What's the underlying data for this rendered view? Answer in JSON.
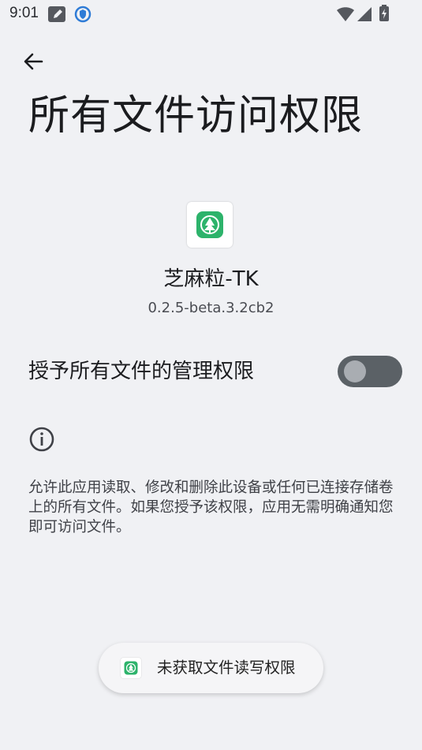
{
  "status_bar": {
    "time": "9:01",
    "icons": [
      "edit-note-icon",
      "shield-icon",
      "wifi-icon",
      "signal-icon",
      "battery-charging-icon"
    ]
  },
  "header": {
    "back_icon": "arrow-left-icon",
    "title": "所有文件访问权限"
  },
  "app": {
    "icon": "tree-leaf-icon",
    "icon_color": "#2db36b",
    "name": "芝麻粒-TK",
    "version": "0.2.5-beta.3.2cb2"
  },
  "permission": {
    "label": "授予所有文件的管理权限",
    "enabled": false
  },
  "info": {
    "icon": "info-icon",
    "description": "允许此应用读取、修改和删除此设备或任何已连接存储卷上的所有文件。如果您授予该权限，应用无需明确通知您即可访问文件。"
  },
  "toast": {
    "icon": "tree-leaf-icon",
    "text": "未获取文件读写权限"
  }
}
